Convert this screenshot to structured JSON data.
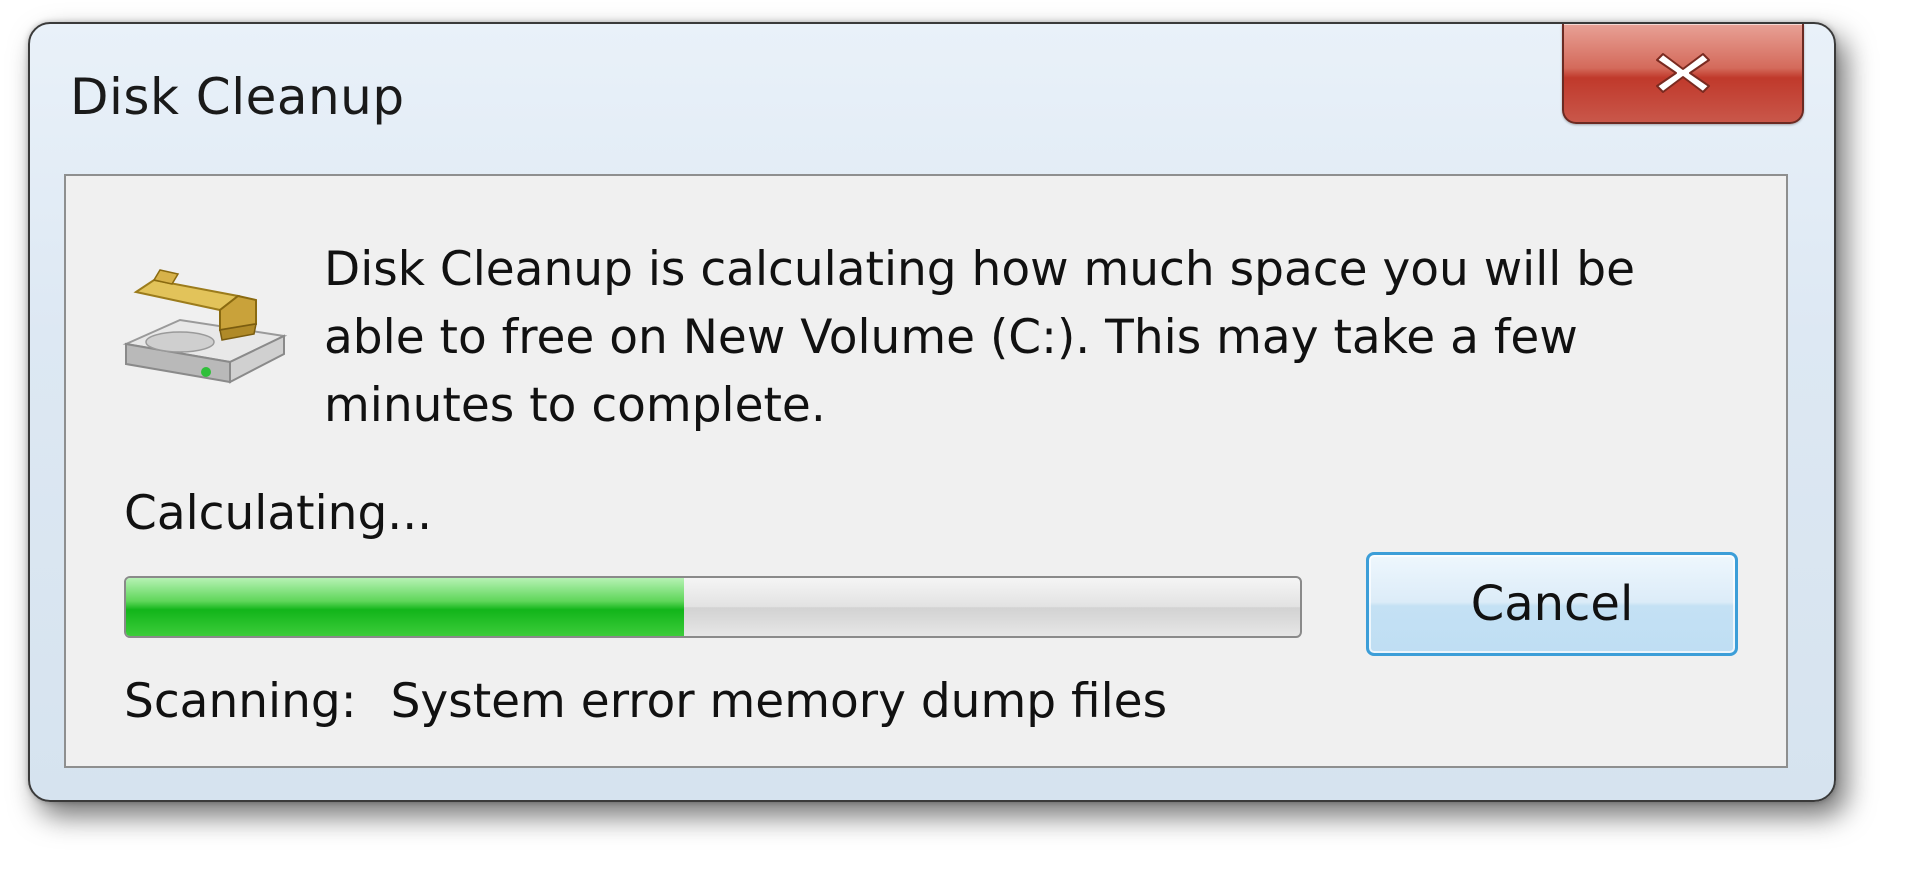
{
  "window": {
    "title": "Disk Cleanup",
    "close_icon": "close-x-icon"
  },
  "content": {
    "icon": "disk-cleanup-drive-icon",
    "message": "Disk Cleanup is calculating how much space you will be able to free on New Volume (C:). This may take a few minutes to complete.",
    "status_label": "Calculating...",
    "progress_percent": 47.5,
    "cancel_label": "Cancel",
    "scan_label": "Scanning:",
    "scan_item": "System error memory dump files"
  },
  "colors": {
    "progress_green": "#12b51a",
    "close_red": "#c0392b",
    "button_focus_blue": "#3c9ed8"
  }
}
